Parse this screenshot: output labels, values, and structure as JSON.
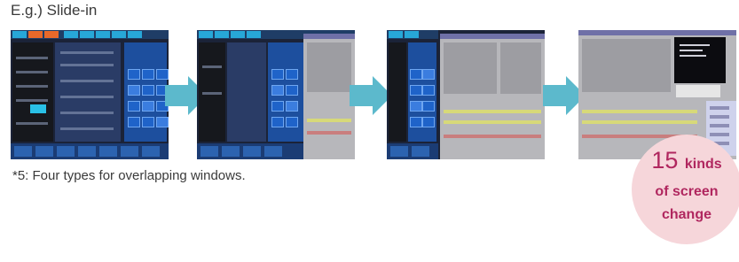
{
  "heading": "E.g.) Slide-in",
  "footnote": "*5: Four types for overlapping windows.",
  "badge": {
    "number": "15",
    "unit": "kinds",
    "line2": "of screen",
    "line3": "change"
  },
  "frames": [
    {
      "name": "frame-1",
      "overlay": "none"
    },
    {
      "name": "frame-2",
      "overlay": "gray-window-sliding-in"
    },
    {
      "name": "frame-3",
      "overlay": "gray-window-covering"
    },
    {
      "name": "frame-4",
      "overlay": "gray-window-with-popups"
    }
  ],
  "colors": {
    "arrow": "#5cb9cc",
    "badge_bg": "#f6d6da",
    "badge_text": "#b0275f",
    "panel_blue": "#1f63c9",
    "window_gray": "#b7b7bb"
  },
  "icons": [
    "right-arrow-icon"
  ]
}
